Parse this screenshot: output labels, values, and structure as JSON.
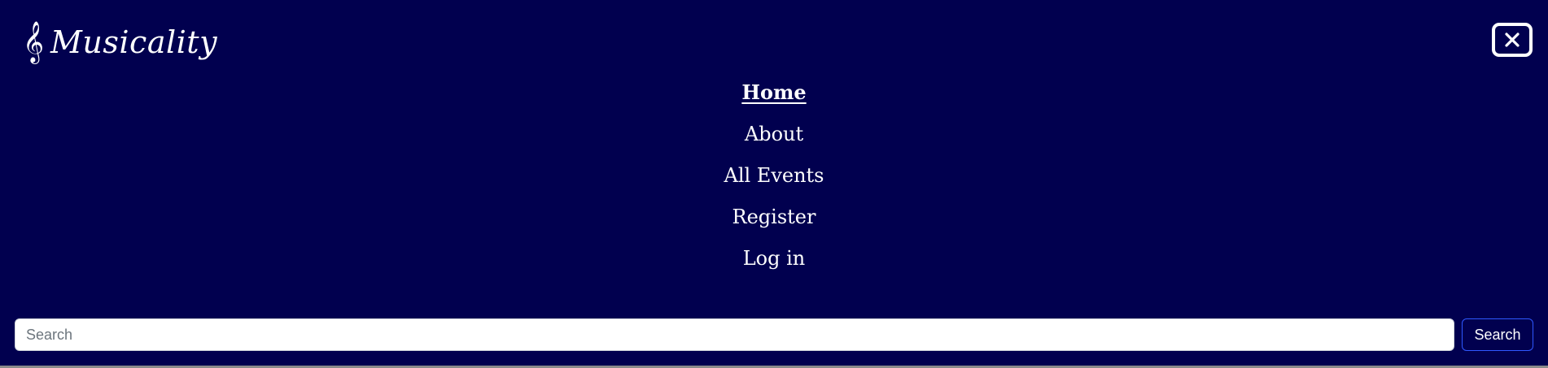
{
  "brand": {
    "icon": "treble-clef-icon",
    "icon_glyph": "𝄞",
    "name": "Musicality"
  },
  "close_button": {
    "icon": "close-icon"
  },
  "nav": {
    "items": [
      {
        "label": "Home",
        "active": true
      },
      {
        "label": "About",
        "active": false
      },
      {
        "label": "All Events",
        "active": false
      },
      {
        "label": "Register",
        "active": false
      },
      {
        "label": "Log in",
        "active": false
      }
    ]
  },
  "search": {
    "placeholder": "Search",
    "value": "",
    "button_label": "Search"
  },
  "colors": {
    "background": "#01004f",
    "text": "#ffffff",
    "search_button_border": "#2f58ff"
  }
}
